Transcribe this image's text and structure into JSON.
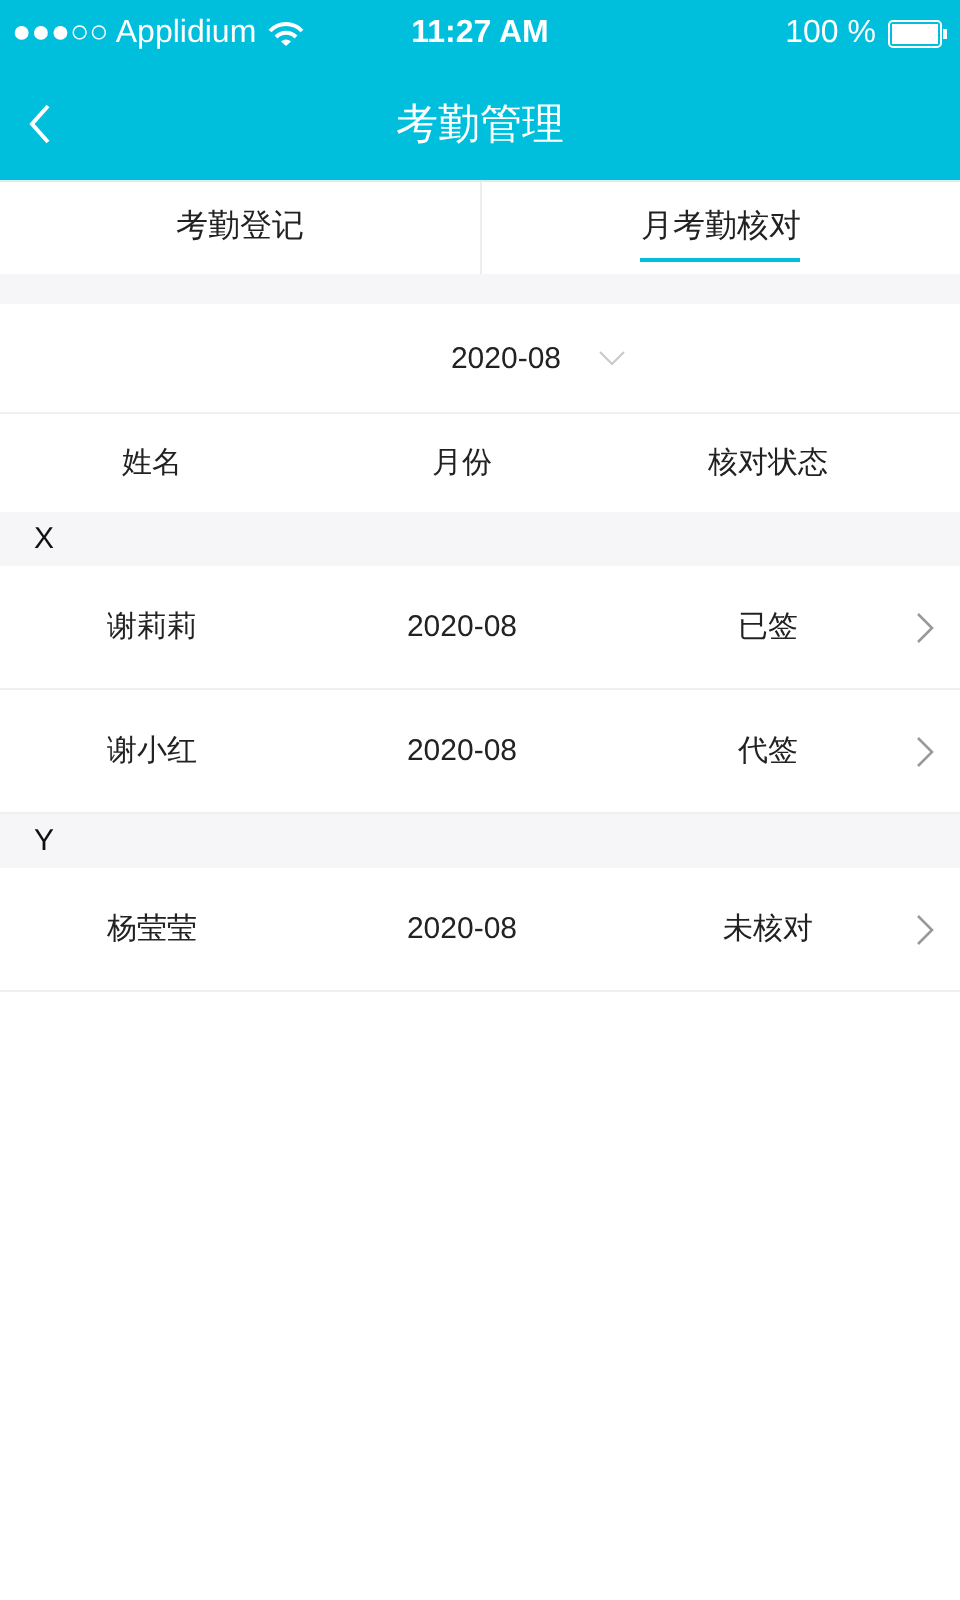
{
  "status_bar": {
    "carrier": "●●●○○ Applidium",
    "time": "11:27 AM",
    "battery": "100 %"
  },
  "nav": {
    "title": "考勤管理"
  },
  "tabs": [
    {
      "label": "考勤登记",
      "selected": false
    },
    {
      "label": "月考勤核对",
      "selected": true
    }
  ],
  "month_picker": {
    "value": "2020-08"
  },
  "table": {
    "columns": [
      "姓名",
      "月份",
      "核对状态"
    ],
    "sections": [
      {
        "letter": "X",
        "rows": [
          {
            "name": "谢莉莉",
            "month": "2020-08",
            "status": "已签"
          },
          {
            "name": "谢小红",
            "month": "2020-08",
            "status": "代签"
          }
        ]
      },
      {
        "letter": "Y",
        "rows": [
          {
            "name": "杨莹莹",
            "month": "2020-08",
            "status": "未核对"
          }
        ]
      }
    ]
  }
}
